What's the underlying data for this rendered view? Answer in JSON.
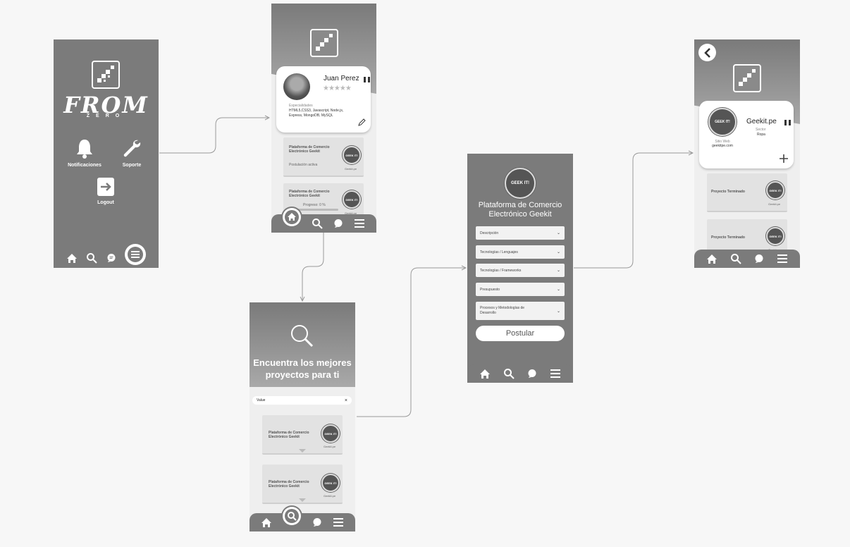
{
  "screen1": {
    "brand_top": "FROM",
    "brand_bottom": "ZERO",
    "notifications_label": "Notificaciones",
    "support_label": "Soporte",
    "logout_label": "Logout"
  },
  "screen2": {
    "user_name": "Juan Perez",
    "specialties_label": "Especialidades",
    "specialties_value": "HTML5,CSS3, Javascript, Node.js, Express, MongoDB, MySQL",
    "card1_title": "Plataforma de Comercio Electrónico Geekit",
    "card1_status": "Postulación activa",
    "card1_company": "Geekit.pe",
    "card2_title": "Plataforma de Comercio Electrónico Geekit",
    "card2_progress_label": "Progreso: 0 %",
    "card2_progress": 0,
    "card2_company": "Geekit.pe"
  },
  "screen3": {
    "headline": "Encuentra los mejores proyectos para ti",
    "search_value": "Value",
    "search_clear": "×",
    "results": [
      {
        "title": "Plataforma de Comercio Electrónico Geekit",
        "company": "Geekit.pe"
      },
      {
        "title": "Plataforma de Comercio Electrónico Geekit",
        "company": "Geekit.pe"
      }
    ]
  },
  "screen4": {
    "title": "Plataforma de Comercio Electrónico Geekit",
    "dropdowns": [
      "Descripción",
      "Tecnologías / Lenguajes",
      "Tecnologías / Frameworks",
      "Presupuesto",
      "Procesos y Metodologías de Desarrollo"
    ],
    "apply_label": "Postular"
  },
  "screen5": {
    "company_name": "Geekit.pe",
    "sector_label": "Sector",
    "sector_value": "Ropa",
    "website_label": "Sitio Web",
    "website_value": "geekitpe.com",
    "projects": [
      {
        "title": "Proyecto Terminado",
        "company": "Geekit.pe"
      },
      {
        "title": "Proyecto Terminado",
        "company": "Geekit.pe"
      }
    ]
  },
  "badge_text": "GEEK IT!",
  "colors": {
    "canvas": "#f7f7f7",
    "screen_dark": "#7b7b7b",
    "connector": "#9a9a9a"
  }
}
